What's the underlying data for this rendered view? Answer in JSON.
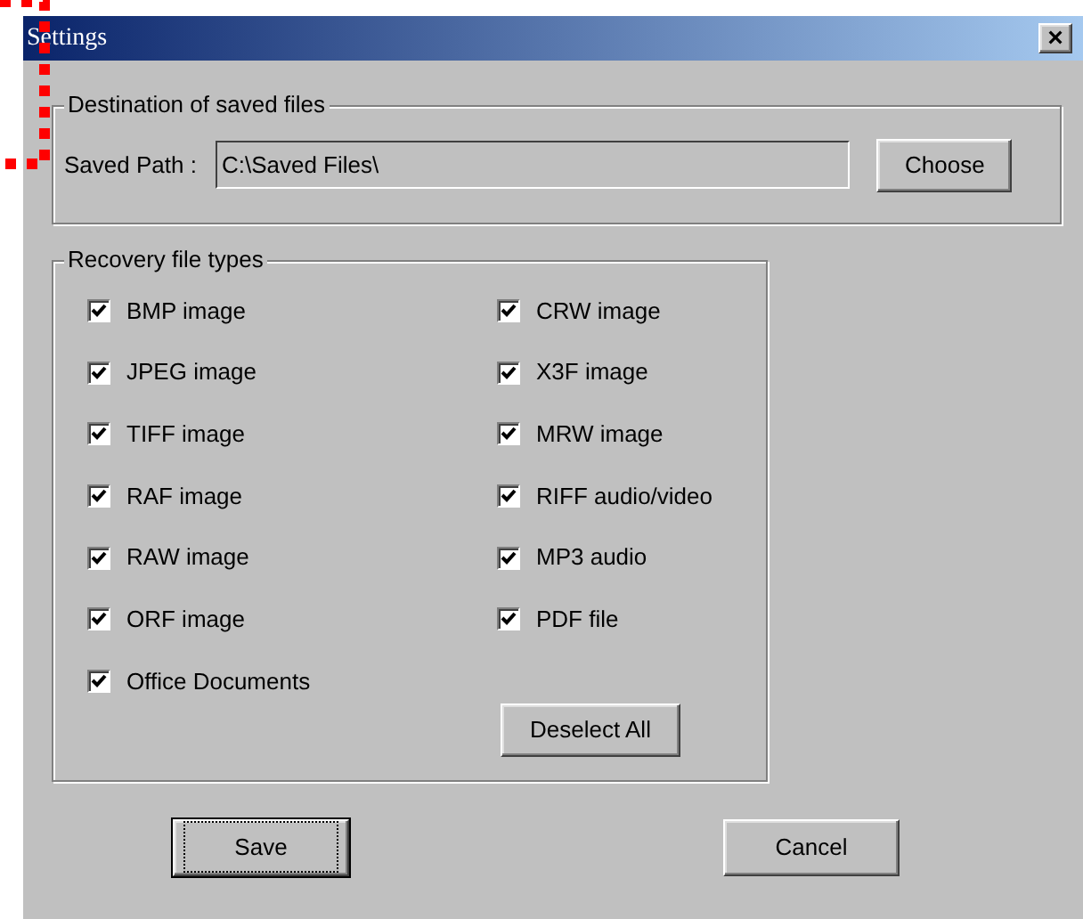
{
  "window": {
    "title": "Settings",
    "close": "×"
  },
  "destination": {
    "legend": "Destination of saved files",
    "label": "Saved Path :",
    "value": "C:\\Saved Files\\",
    "button": "Choose"
  },
  "recovery": {
    "legend": "Recovery file types",
    "columns": [
      [
        {
          "label": "BMP image",
          "checked": true
        },
        {
          "label": "JPEG image",
          "checked": true
        },
        {
          "label": "TIFF image",
          "checked": true
        },
        {
          "label": "RAF image",
          "checked": true
        },
        {
          "label": "RAW image",
          "checked": true
        },
        {
          "label": "ORF image",
          "checked": true
        },
        {
          "label": "Office Documents",
          "checked": true
        }
      ],
      [
        {
          "label": "CRW image",
          "checked": true
        },
        {
          "label": "X3F image",
          "checked": true
        },
        {
          "label": "MRW image",
          "checked": true
        },
        {
          "label": "RIFF audio/video",
          "checked": true
        },
        {
          "label": "MP3 audio",
          "checked": true
        },
        {
          "label": "PDF file",
          "checked": true
        }
      ]
    ],
    "button": "Deselect All"
  },
  "buttons": [
    {
      "label": "Save",
      "default": true
    },
    {
      "label": "Cancel",
      "default": false
    }
  ]
}
